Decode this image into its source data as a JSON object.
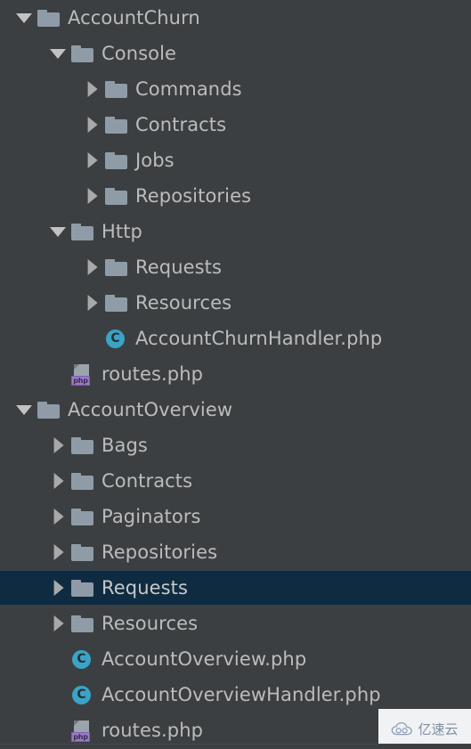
{
  "panel": {
    "name": "project-file-tree",
    "background_color": "#3c3f41",
    "text_color": "#bcbcbc",
    "selection_color": "#0e2b41",
    "folder_icon_color": "#8f9ca8",
    "class_icon_color": "#3ba3c7",
    "php_badge_color": "#9b7cc4"
  },
  "rows": [
    {
      "label": "AccountChurn",
      "depth": 0,
      "toggle": "expanded",
      "icon": "folder-icon",
      "selected": false
    },
    {
      "label": "Console",
      "depth": 1,
      "toggle": "expanded",
      "icon": "folder-icon",
      "selected": false
    },
    {
      "label": "Commands",
      "depth": 2,
      "toggle": "collapsed",
      "icon": "folder-icon",
      "selected": false
    },
    {
      "label": "Contracts",
      "depth": 2,
      "toggle": "collapsed",
      "icon": "folder-icon",
      "selected": false
    },
    {
      "label": "Jobs",
      "depth": 2,
      "toggle": "collapsed",
      "icon": "folder-icon",
      "selected": false
    },
    {
      "label": "Repositories",
      "depth": 2,
      "toggle": "collapsed",
      "icon": "folder-icon",
      "selected": false
    },
    {
      "label": "Http",
      "depth": 1,
      "toggle": "expanded",
      "icon": "folder-icon",
      "selected": false
    },
    {
      "label": "Requests",
      "depth": 2,
      "toggle": "collapsed",
      "icon": "folder-icon",
      "selected": false
    },
    {
      "label": "Resources",
      "depth": 2,
      "toggle": "collapsed",
      "icon": "folder-icon",
      "selected": false
    },
    {
      "label": "AccountChurnHandler.php",
      "depth": 2,
      "toggle": "none",
      "icon": "php-class-icon",
      "selected": false
    },
    {
      "label": "routes.php",
      "depth": 1,
      "toggle": "none",
      "icon": "php-file-icon",
      "selected": false
    },
    {
      "label": "AccountOverview",
      "depth": 0,
      "toggle": "expanded",
      "icon": "folder-icon",
      "selected": false
    },
    {
      "label": "Bags",
      "depth": 1,
      "toggle": "collapsed",
      "icon": "folder-icon",
      "selected": false
    },
    {
      "label": "Contracts",
      "depth": 1,
      "toggle": "collapsed",
      "icon": "folder-icon",
      "selected": false
    },
    {
      "label": "Paginators",
      "depth": 1,
      "toggle": "collapsed",
      "icon": "folder-icon",
      "selected": false
    },
    {
      "label": "Repositories",
      "depth": 1,
      "toggle": "collapsed",
      "icon": "folder-icon",
      "selected": false
    },
    {
      "label": "Requests",
      "depth": 1,
      "toggle": "collapsed",
      "icon": "folder-icon",
      "selected": true
    },
    {
      "label": "Resources",
      "depth": 1,
      "toggle": "collapsed",
      "icon": "folder-icon",
      "selected": false
    },
    {
      "label": "AccountOverview.php",
      "depth": 1,
      "toggle": "none",
      "icon": "php-class-icon",
      "selected": false
    },
    {
      "label": "AccountOverviewHandler.php",
      "depth": 1,
      "toggle": "none",
      "icon": "php-class-icon",
      "selected": false
    },
    {
      "label": "routes.php",
      "depth": 1,
      "toggle": "none",
      "icon": "php-file-icon",
      "selected": false
    }
  ],
  "php_badge_label": "php",
  "class_icon_letter": "C",
  "watermark": {
    "text": "亿速云",
    "logo": "cloud-icon"
  }
}
